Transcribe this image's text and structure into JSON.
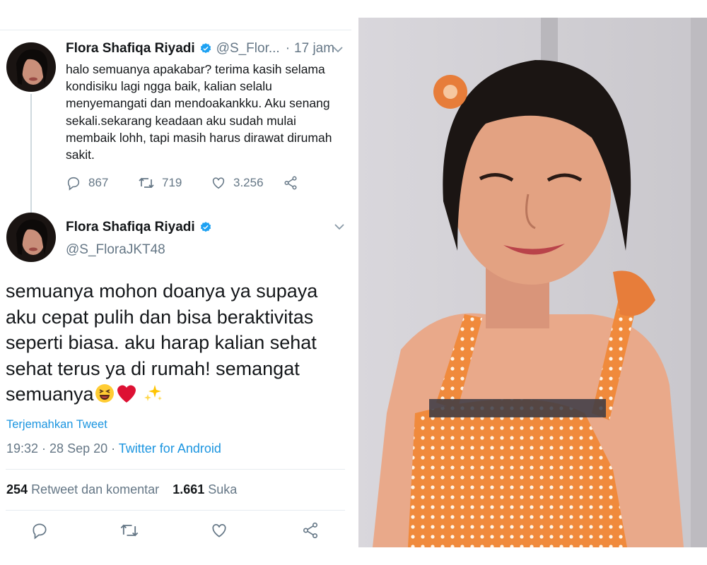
{
  "tweet_reply": {
    "name": "Flora Shafiqa Riyadi",
    "handle": "@S_Flor...",
    "dot": "·",
    "time": "17 jam",
    "text": "halo semuanya apakabar? terima kasih selama kondisiku lagi ngga baik, kalian selalu menyemangati dan mendoakankku. Aku senang sekali.sekarang keadaan aku sudah mulai membaik lohh, tapi masih harus dirawat dirumah sakit.",
    "reply_count": "867",
    "retweet_count": "719",
    "like_count": "3.256"
  },
  "tweet_main": {
    "name": "Flora Shafiqa Riyadi",
    "handle": "@S_FloraJKT48",
    "text": "semuanya mohon doanya ya supaya aku cepat pulih dan bisa beraktivitas seperti biasa. aku harap kalian sehat sehat terus ya di rumah! semangat semuanya",
    "translate_label": "Terjemahkan Tweet",
    "timestamp": "19:32 · 28 Sep 20 · ",
    "source": "Twitter for Android",
    "retweet_stat": "254",
    "retweet_stat_label": "Retweet dan komentar",
    "like_stat": "1.661",
    "like_stat_label": "Suka"
  },
  "icons": {
    "verified": "verified-badge-icon",
    "caret": "chevron-down-icon",
    "reply": "reply-icon",
    "retweet": "retweet-icon",
    "like": "heart-icon",
    "share": "share-icon"
  },
  "colors": {
    "accent": "#1b95e0",
    "muted": "#657786",
    "text": "#14171a",
    "heart": "#e0245e"
  }
}
